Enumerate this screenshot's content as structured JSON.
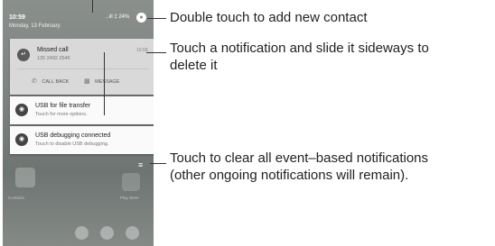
{
  "status_bar": {
    "time": "10:59",
    "date": "Monday, 13 February",
    "indicators": "..ıll ‡ 24%"
  },
  "notifications": {
    "missed_call": {
      "title": "Missed call",
      "number": "135 2492 2546",
      "time": "10:58",
      "call_back_label": "CALL BACK",
      "message_label": "MESSAGE"
    },
    "usb_transfer": {
      "title": "USB for file transfer",
      "subtitle": "Touch for more options."
    },
    "usb_debugging": {
      "title": "USB debugging connected",
      "subtitle": "Touch to disable USB debugging."
    }
  },
  "home_labels": [
    "Contacts",
    "Play Store"
  ],
  "callouts": {
    "add_contact": "Double touch to add new contact",
    "slide_notification": [
      "Touch a notification and slide it sideways to",
      "delete it"
    ],
    "clear_all": [
      "Touch to clear all event–based notifications",
      "(other ongoing notifications will remain)."
    ]
  },
  "colors": {
    "card_background": "#fafafa",
    "missed_call_card": "#d9d9d9",
    "text_dark": "#222222",
    "leader_line": "#333333"
  },
  "icons": [
    "missed-call-icon",
    "phone-icon",
    "message-icon",
    "usb-icon",
    "bug-icon",
    "avatar-icon",
    "clear-all-icon"
  ]
}
